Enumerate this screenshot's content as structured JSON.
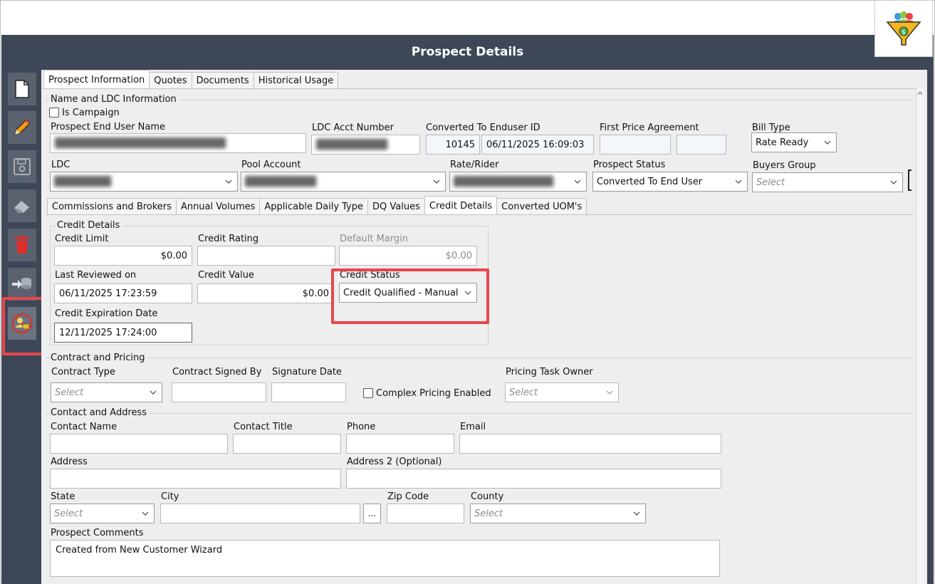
{
  "window": {
    "title": "Prospect Details"
  },
  "toolbar": {
    "icons": [
      "new-document-icon",
      "edit-pencil-icon",
      "save-icon",
      "eraser-icon",
      "delete-trash-icon",
      "convert-icon",
      "credit-user-icon"
    ]
  },
  "main_tabs": [
    "Prospect Information",
    "Quotes",
    "Documents",
    "Historical Usage"
  ],
  "name_ldc": {
    "section": "Name and LDC Information",
    "is_campaign_label": "Is Campaign",
    "prospect_end_user_name_label": "Prospect End User Name",
    "ldc_acct_number_label": "LDC Acct Number",
    "converted_to_enduser_id_label": "Converted To Enduser ID",
    "converted_id": "10145",
    "converted_date": "06/11/2025 16:09:03",
    "first_price_agreement_label": "First Price Agreement",
    "bill_type_label": "Bill Type",
    "bill_type_value": "Rate Ready",
    "ldc_label": "LDC",
    "pool_account_label": "Pool Account",
    "rate_rider_label": "Rate/Rider",
    "prospect_status_label": "Prospect Status",
    "prospect_status_value": "Converted To End User",
    "buyers_group_label": "Buyers Group",
    "buyers_group_placeholder": "Select"
  },
  "sub_tabs": [
    "Commissions and Brokers",
    "Annual Volumes",
    "Applicable Daily Type",
    "DQ Values",
    "Credit Details",
    "Converted UOM's"
  ],
  "credit": {
    "section": "Credit Details",
    "credit_limit_label": "Credit Limit",
    "credit_limit_value": "$0.00",
    "credit_rating_label": "Credit Rating",
    "default_margin_label": "Default Margin",
    "default_margin_value": "$0.00",
    "last_reviewed_label": "Last Reviewed on",
    "last_reviewed_value": "06/11/2025 17:23:59",
    "credit_value_label": "Credit Value",
    "credit_value_value": "$0.00",
    "credit_status_label": "Credit Status",
    "credit_status_value": "Credit Qualified - Manual",
    "credit_expiration_label": "Credit Expiration Date",
    "credit_expiration_value": "12/11/2025 17:24:00"
  },
  "contract": {
    "section": "Contract and Pricing",
    "contract_type_label": "Contract Type",
    "contract_type_placeholder": "Select",
    "contract_signed_by_label": "Contract Signed By",
    "signature_date_label": "Signature Date",
    "complex_pricing_label": "Complex Pricing Enabled",
    "pricing_task_owner_label": "Pricing Task Owner",
    "pricing_task_owner_placeholder": "Select"
  },
  "contact": {
    "section": "Contact and Address",
    "contact_name_label": "Contact Name",
    "contact_title_label": "Contact Title",
    "phone_label": "Phone",
    "email_label": "Email",
    "address_label": "Address",
    "address2_label": "Address 2 (Optional)",
    "state_label": "State",
    "state_placeholder": "Select",
    "city_label": "City",
    "city_button": "...",
    "zip_label": "Zip Code",
    "county_label": "County",
    "county_placeholder": "Select",
    "comments_label": "Prospect Comments",
    "comments_value": "Created from New Customer Wizard"
  }
}
